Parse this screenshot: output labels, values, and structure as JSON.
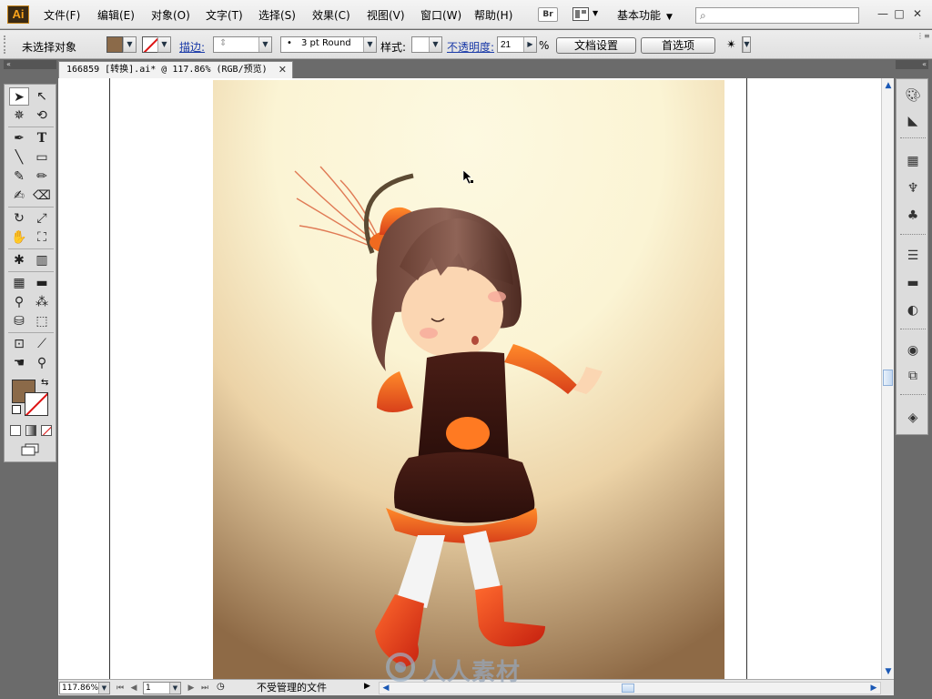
{
  "app": {
    "logo_text": "Ai",
    "menu": [
      {
        "label": "文件(F)"
      },
      {
        "label": "编辑(E)"
      },
      {
        "label": "对象(O)"
      },
      {
        "label": "文字(T)"
      },
      {
        "label": "选择(S)"
      },
      {
        "label": "效果(C)"
      },
      {
        "label": "视图(V)"
      },
      {
        "label": "窗口(W)"
      },
      {
        "label": "帮助(H)"
      }
    ],
    "bridge_label": "Br",
    "workspace": "基本功能",
    "search": {
      "value": "",
      "placeholder": ""
    }
  },
  "control_bar": {
    "selection_status": "未选择对象",
    "stroke_link": "描边:",
    "brush_value": "3 pt Round",
    "style_label": "样式:",
    "opacity_link": "不透明度:",
    "opacity_value": "21",
    "percent_sign": "%",
    "doc_setup_button": "文档设置",
    "preferences_button": "首选项",
    "fill_color": "#8b6a49"
  },
  "document": {
    "tab_title": "166859 [转换].ai* @ 117.86% (RGB/预览)",
    "zoom": "117.86%",
    "page": "1",
    "status": "不受管理的文件"
  },
  "watermark": {
    "text": "人人素材"
  },
  "colors": {
    "accent": "#f7a21b",
    "link": "#1a3aa8"
  }
}
